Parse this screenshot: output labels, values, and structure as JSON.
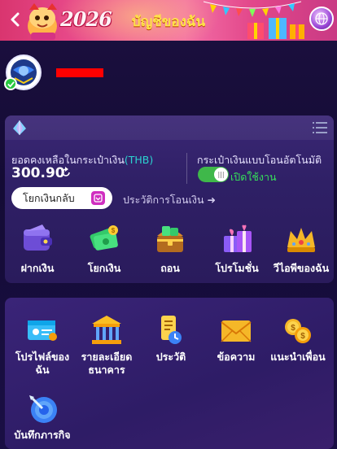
{
  "header": {
    "year": "2026",
    "title": "บัญชีของฉัน",
    "back_icon": "back-arrow-icon",
    "globe_icon": "globe-icon"
  },
  "profile": {
    "avatar_icon": "avatar-icon",
    "verified_icon": "check-icon"
  },
  "wallet": {
    "balance_label": "ยอดคงเหลือในกระเป๋าเงิน",
    "currency": "(THB)",
    "balance": "300.90",
    "auto_transfer_label": "กระเป๋าเงินแบบโอนอัตโนมัติ",
    "toggle_state": "เปิดใช้งาน",
    "toggle_on": true,
    "withdraw_back_label": "โยกเงินกลับ",
    "history_label": "ประวัติการโอนเงิน ➜",
    "actions": [
      {
        "label": "ฝากเงิน",
        "icon": "wallet-icon"
      },
      {
        "label": "โยกเงิน",
        "icon": "money-icon"
      },
      {
        "label": "ถอน",
        "icon": "treasure-chest-icon"
      },
      {
        "label": "โปรโมชั่น",
        "icon": "gift-icon"
      },
      {
        "label": "วีไอพีของฉัน",
        "icon": "crown-icon"
      }
    ]
  },
  "menu": {
    "items": [
      {
        "label_line1": "โปรไฟล์ของ",
        "label_line2": "ฉัน",
        "icon": "profile-card-icon"
      },
      {
        "label_line1": "รายละเอียด",
        "label_line2": "ธนาคาร",
        "icon": "bank-icon"
      },
      {
        "label_line1": "ประวัติ",
        "label_line2": "",
        "icon": "history-icon"
      },
      {
        "label_line1": "ข้อความ",
        "label_line2": "",
        "icon": "envelope-icon"
      },
      {
        "label_line1": "แนะนำเพื่อน",
        "label_line2": "",
        "icon": "coins-icon"
      },
      {
        "label_line1": "บันทึกภารกิจ",
        "label_line2": "",
        "icon": "target-icon"
      }
    ]
  },
  "colors": {
    "accent_teal": "#2bd3d0",
    "toggle_green": "#3fb84a",
    "title_yellow": "#ffe34a"
  }
}
